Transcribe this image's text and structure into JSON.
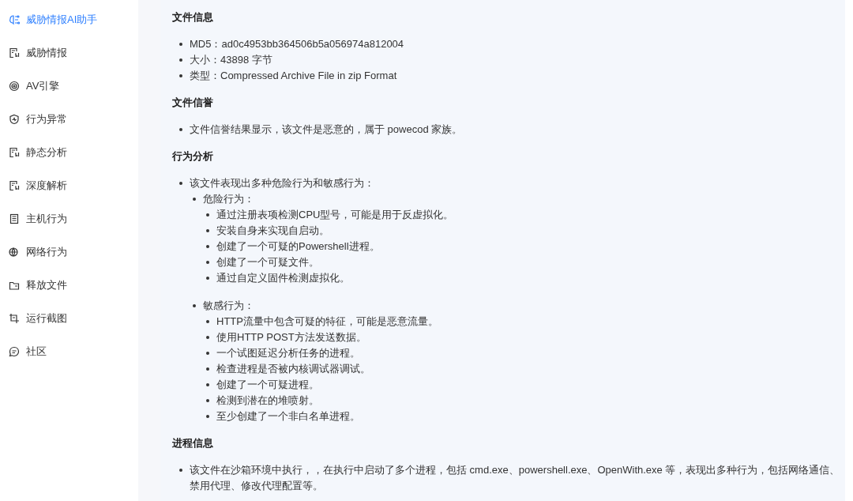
{
  "sidebar": {
    "items": [
      {
        "label": "威胁情报AI助手",
        "selected": true
      },
      {
        "label": "威胁情报",
        "selected": false
      },
      {
        "label": "AV引擎",
        "selected": false
      },
      {
        "label": "行为异常",
        "selected": false
      },
      {
        "label": "静态分析",
        "selected": false
      },
      {
        "label": "深度解析",
        "selected": false
      },
      {
        "label": "主机行为",
        "selected": false
      },
      {
        "label": "网络行为",
        "selected": false
      },
      {
        "label": "释放文件",
        "selected": false
      },
      {
        "label": "运行截图",
        "selected": false
      },
      {
        "label": "社区",
        "selected": false
      }
    ]
  },
  "report": {
    "sections": [
      {
        "title": "文件信息",
        "items": [
          {
            "text": "MD5：ad0c4953bb364506b5a056974a812004"
          },
          {
            "text": "大小：43898 字节"
          },
          {
            "text": "类型：Compressed Archive File in zip Format"
          }
        ]
      },
      {
        "title": "文件信誉",
        "items": [
          {
            "text": "文件信誉结果显示，该文件是恶意的，属于 powecod 家族。"
          }
        ]
      },
      {
        "title": "行为分析",
        "items": [
          {
            "text": "该文件表现出多种危险行为和敏感行为：",
            "children": [
              {
                "text": "危险行为：",
                "children": [
                  {
                    "text": "通过注册表项检测CPU型号，可能是用于反虚拟化。"
                  },
                  {
                    "text": "安装自身来实现自启动。"
                  },
                  {
                    "text": "创建了一个可疑的Powershell进程。"
                  },
                  {
                    "text": "创建了一个可疑文件。"
                  },
                  {
                    "text": "通过自定义固件检测虚拟化。"
                  }
                ]
              },
              {
                "text": "敏感行为：",
                "children": [
                  {
                    "text": "HTTP流量中包含可疑的特征，可能是恶意流量。"
                  },
                  {
                    "text": "使用HTTP POST方法发送数据。"
                  },
                  {
                    "text": "一个试图延迟分析任务的进程。"
                  },
                  {
                    "text": "检查进程是否被内核调试器调试。"
                  },
                  {
                    "text": "创建了一个可疑进程。"
                  },
                  {
                    "text": "检测到潜在的堆喷射。"
                  },
                  {
                    "text": "至少创建了一个非白名单进程。"
                  }
                ]
              }
            ]
          }
        ]
      },
      {
        "title": "进程信息",
        "items": [
          {
            "text": "该文件在沙箱环境中执行，，在执行中启动了多个进程，包括 cmd.exe、powershell.exe、OpenWith.exe 等，表现出多种行为，包括网络通信、禁用代理、修改代理配置等。"
          }
        ]
      }
    ]
  }
}
